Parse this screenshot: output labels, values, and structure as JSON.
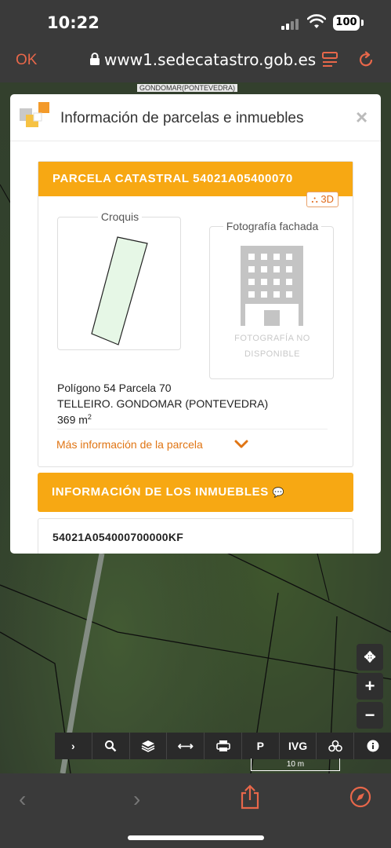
{
  "status_bar": {
    "time": "10:22",
    "battery": "100"
  },
  "browser": {
    "ok_label": "OK",
    "url": "www1.sedecatastro.gob.es"
  },
  "map": {
    "place_label": "GONDOMAR(PONTEVEDRA)",
    "scale_label": "10 m",
    "toolbar": [
      "›",
      "search-icon",
      "layers-icon",
      "measure-icon",
      "print-icon",
      "parking-icon",
      "IVG",
      "3d-icon",
      "info-icon"
    ],
    "toolbar_text": {
      "ivg": "IVG"
    }
  },
  "modal": {
    "title": "Información de parcelas e inmuebles",
    "close": "×",
    "parcel": {
      "header": "PARCELA CATASTRAL 54021A05400070",
      "badge": "3D",
      "croquis_label": "Croquis",
      "foto_label": "Fotografía fachada",
      "foto_na_line1": "FOTOGRAFÍA NO",
      "foto_na_line2": "DISPONIBLE",
      "line1": "Polígono 54 Parcela 70",
      "line2": "TELLEIRO. GONDOMAR (PONTEVEDRA)",
      "area": "369 m",
      "area_unit_sup": "2",
      "more_info": "Más información de la parcela"
    },
    "inmuebles": {
      "header": "INFORMACIÓN DE LOS INMUEBLES",
      "ref": "54021A054000700000KF"
    }
  },
  "colors": {
    "accent": "#f7a813",
    "link": "#e07514",
    "browser_accent": "#e8674a"
  }
}
